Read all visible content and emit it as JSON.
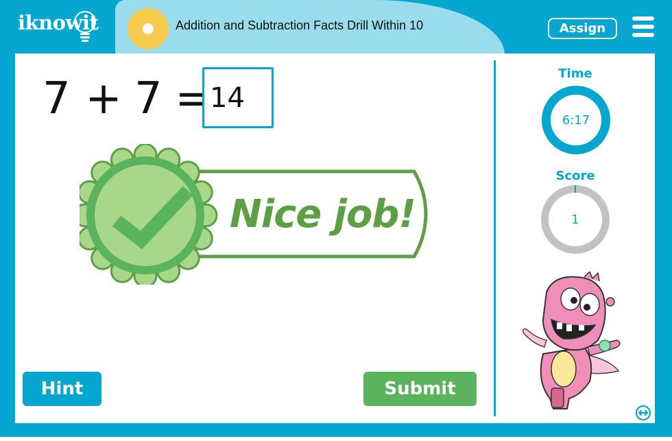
{
  "header": {
    "logo_text": "iknowit",
    "title": "Addition and Subtraction Facts Drill Within 10",
    "assign_label": "Assign",
    "menu_icon": "hamburger-menu-icon"
  },
  "question": {
    "operand_a": "7",
    "operator": "+",
    "operand_b": "7",
    "equals": "=",
    "answer_value": "14"
  },
  "feedback": {
    "message": "Nice job!",
    "icon": "checkmark-badge-icon"
  },
  "actions": {
    "hint_label": "Hint",
    "submit_label": "Submit"
  },
  "sidebar": {
    "time_label": "Time",
    "time_value": "6:17",
    "score_label": "Score",
    "score_value": "1",
    "expand_icon": "expand-horizontal-icon"
  },
  "colors": {
    "brand_blue": "#05a6cf",
    "banner_light_blue": "#99dcec",
    "accent_yellow": "#f6cb4d",
    "success_green": "#5cb35e",
    "badge_dark_green": "#5e9e44",
    "badge_light_green": "#a9d789",
    "ring_gray": "#c2c2c2"
  }
}
